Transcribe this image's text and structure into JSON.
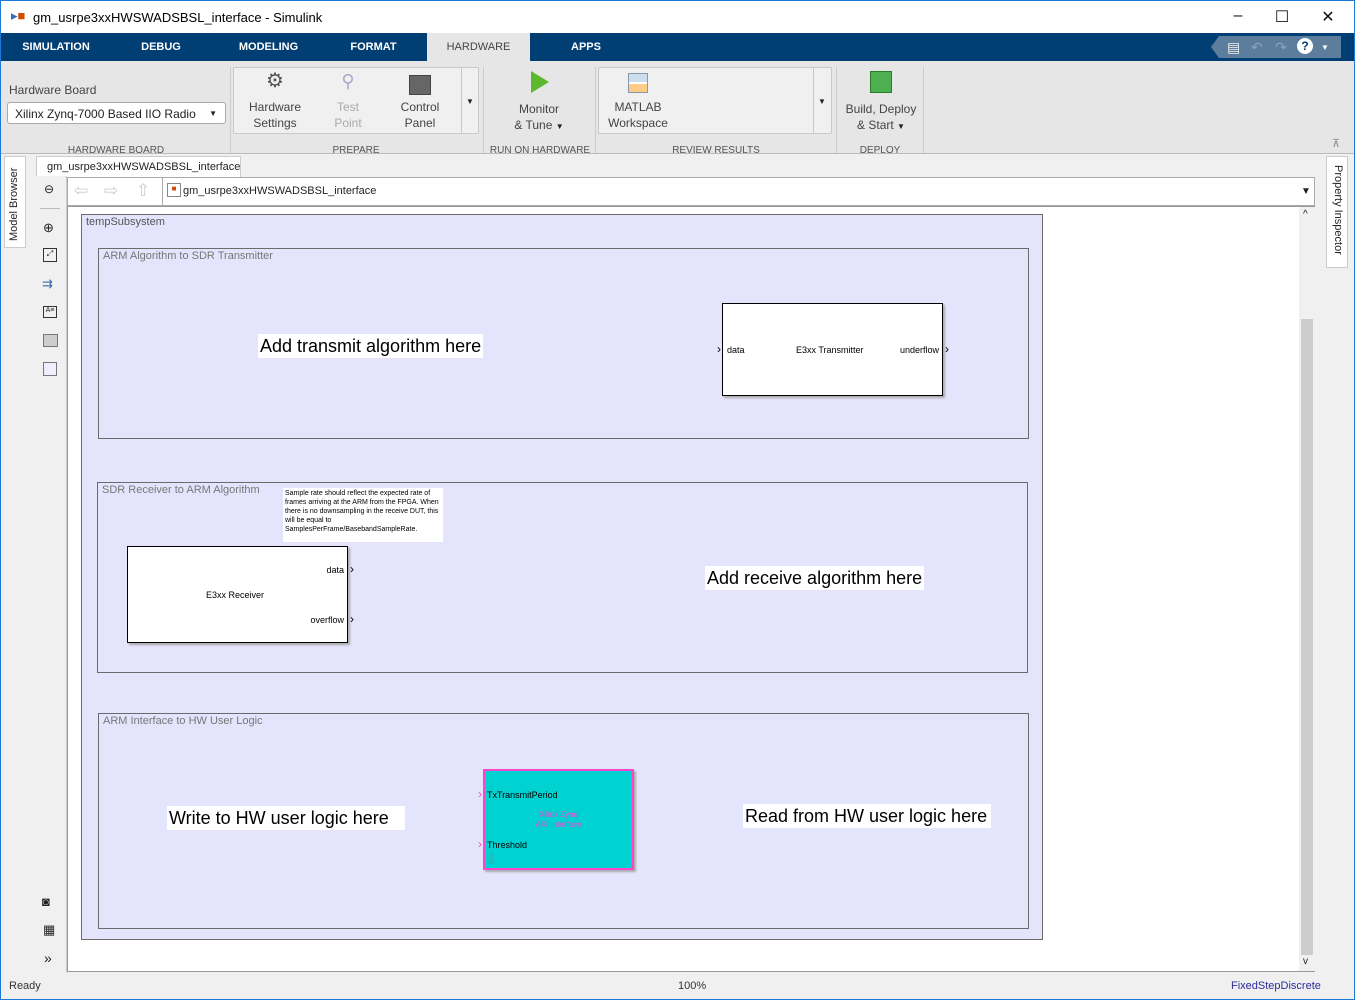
{
  "window": {
    "title": "gm_usrpe3xxHWSWADSBSL_interface - Simulink",
    "minimize": "–",
    "maximize": "☐",
    "close": "✕"
  },
  "tabs": [
    {
      "label": "SIMULATION"
    },
    {
      "label": "DEBUG"
    },
    {
      "label": "MODELING"
    },
    {
      "label": "FORMAT"
    },
    {
      "label": "HARDWARE",
      "active": true
    },
    {
      "label": "APPS"
    }
  ],
  "quick_access": {
    "save": "save-icon",
    "undo": "undo-icon",
    "redo": "redo-icon",
    "help": "?",
    "more": "▼"
  },
  "ribbon": {
    "hardware_board": {
      "label": "Hardware Board",
      "value": "Xilinx Zynq-7000 Based IIO Radio",
      "group": "HARDWARE BOARD"
    },
    "prepare": {
      "group": "PREPARE",
      "hardware_settings": "Hardware Settings",
      "test_point": "Test Point",
      "control_panel": "Control Panel"
    },
    "run": {
      "group": "RUN ON HARDWARE",
      "monitor_tune_1": "Monitor",
      "monitor_tune_2": "& Tune"
    },
    "review": {
      "group": "REVIEW RESULTS",
      "workspace_1": "MATLAB",
      "workspace_2": "Workspace"
    },
    "deploy": {
      "group": "DEPLOY",
      "build_1": "Build, Deploy",
      "build_2": "& Start"
    }
  },
  "side": {
    "model_browser": "Model Browser",
    "property_inspector": "Property Inspector"
  },
  "editor": {
    "tab": "gm_usrpe3xxHWSWADSBSL_interface",
    "address": "gm_usrpe3xxHWSWADSBSL_interface"
  },
  "diagram": {
    "subsystem": "tempSubsystem",
    "area_tx": "ARM Algorithm to SDR Transmitter",
    "area_rx": "SDR Receiver to ARM Algorithm",
    "area_hw": "ARM Interface to HW User Logic",
    "tx_note": "Add transmit algorithm here",
    "rx_note": "Add receive algorithm here",
    "write_note": "Write to HW user logic here",
    "read_note": "Read from HW user logic here",
    "sample_note": "Sample rate should reflect the expected rate of frames arriving at the ARM from the FPGA. When there is no downsampling in the receive DUT, this will be equal to SamplesPerFrame/BasebandSampleRate.",
    "tx_block": {
      "name": "E3xx Transmitter",
      "in": "data",
      "out": "underflow"
    },
    "rx_block": {
      "name": "E3xx Receiver",
      "out1": "data",
      "out2": "overflow"
    },
    "axi_block": {
      "line1": "Xilinx Zynq",
      "line2": "AXI Interface",
      "in1": "TxTransmitPeriod",
      "in2": "Threshold",
      "fill": "#00d2d2",
      "border": "#ff44cc"
    }
  },
  "status": {
    "state": "Ready",
    "zoom": "100%",
    "solver": "FixedStepDiscrete"
  }
}
